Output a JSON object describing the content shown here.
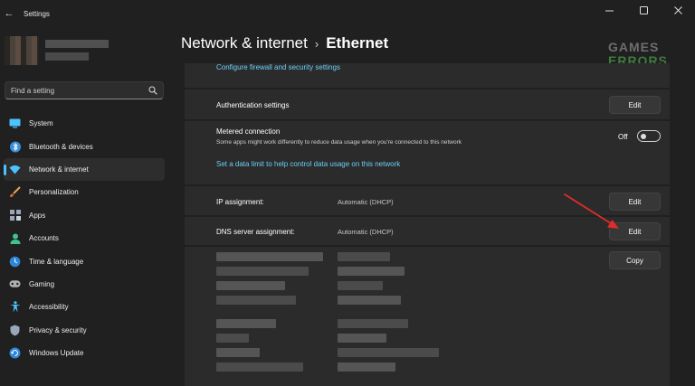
{
  "window": {
    "title": "Settings",
    "back_glyph": "←",
    "controls": [
      "minimize-icon",
      "maximize-icon",
      "close-icon"
    ]
  },
  "user": {
    "name": "",
    "email": ""
  },
  "search": {
    "placeholder": "Find a setting",
    "value": ""
  },
  "sidebar": {
    "items": [
      {
        "label": "System",
        "icon": "system-icon",
        "color": "#4cc2ff"
      },
      {
        "label": "Bluetooth & devices",
        "icon": "bluetooth-icon",
        "color": "#4cc2ff"
      },
      {
        "label": "Network & internet",
        "icon": "wifi-icon",
        "color": "#4cc2ff",
        "selected": true
      },
      {
        "label": "Personalization",
        "icon": "brush-icon",
        "color": "#e8a25a"
      },
      {
        "label": "Apps",
        "icon": "apps-icon",
        "color": "#9aa7b8"
      },
      {
        "label": "Accounts",
        "icon": "accounts-icon",
        "color": "#3fc28b"
      },
      {
        "label": "Time & language",
        "icon": "globe-clock-icon",
        "color": "#4cc2ff"
      },
      {
        "label": "Gaming",
        "icon": "gamepad-icon",
        "color": "#b0b0b0"
      },
      {
        "label": "Accessibility",
        "icon": "accessibility-icon",
        "color": "#4cc2ff"
      },
      {
        "label": "Privacy & security",
        "icon": "shield-icon",
        "color": "#9aa7b8"
      },
      {
        "label": "Windows Update",
        "icon": "update-icon",
        "color": "#4cc2ff"
      }
    ]
  },
  "header": {
    "breadcrumb_parent": "Network & internet",
    "breadcrumb_separator": "›",
    "breadcrumb_current": "Ethernet"
  },
  "watermark": {
    "line1": "GAMES",
    "line2": "ERRORS"
  },
  "content": {
    "firewall_link": "Configure firewall and security settings",
    "auth": {
      "label": "Authentication settings",
      "button": "Edit"
    },
    "metered": {
      "label": "Metered connection",
      "description": "Some apps might work differently to reduce data usage when you're connected to this network",
      "toggle_label": "Off",
      "toggle_on": false,
      "data_limit_link": "Set a data limit to help control data usage on this network"
    },
    "ip": {
      "label": "IP assignment:",
      "value": "Automatic (DHCP)",
      "button": "Edit"
    },
    "dns": {
      "label": "DNS server assignment:",
      "value": "Automatic (DHCP)",
      "button": "Edit"
    },
    "copy_button": "Copy"
  },
  "colors": {
    "accent": "#4cc2ff",
    "link": "#6ccff6",
    "annotation_arrow": "#e02b2b",
    "watermark_gray": "#6e6e6e",
    "watermark_green": "#3f7a3f"
  }
}
